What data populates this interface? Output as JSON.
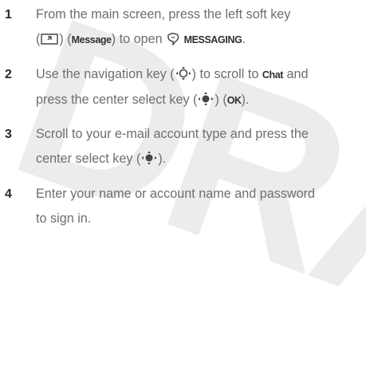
{
  "watermark": "DRA",
  "steps": [
    {
      "number": "1",
      "parts": {
        "a": "From the main screen, press the left soft key",
        "b": "(",
        "c": ") (",
        "d": "Message",
        "e": ") to open ",
        "f": "MESSAGING",
        "g": "."
      }
    },
    {
      "number": "2",
      "parts": {
        "a": "Use the navigation key (",
        "b": ") to scroll to ",
        "c": "Chat",
        "d": " and",
        "e": "press the center select key (",
        "f": ") (",
        "g": "OK",
        "h": ")."
      }
    },
    {
      "number": "3",
      "parts": {
        "a": "Scroll to your e-mail account type and press the",
        "b": "center select key (",
        "c": ")."
      }
    },
    {
      "number": "4",
      "parts": {
        "a": "Enter your name or account name and password",
        "b": "to sign in."
      }
    }
  ],
  "icons": {
    "soft_key": "left-soft-key-icon",
    "messaging": "messaging-icon",
    "nav_key": "navigation-key-icon",
    "select_key": "center-select-key-icon"
  }
}
